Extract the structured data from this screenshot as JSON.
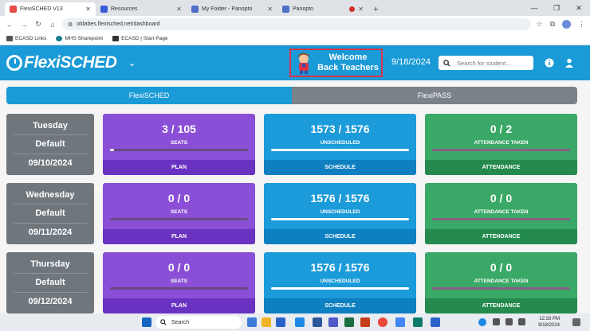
{
  "browser": {
    "tabs": [
      {
        "label": "FlexiSCHED V13",
        "active": true,
        "color": "#e54b4b"
      },
      {
        "label": "Resources",
        "active": false,
        "color": "#3a5bd9"
      },
      {
        "label": "My Folder - Panopto",
        "active": false,
        "color": "#4f6fc9"
      },
      {
        "label": "Panopto",
        "active": false,
        "color": "#4f6fc9"
      }
    ],
    "url": "oldabes.flexisched.net/dashboard",
    "bookmarks": [
      "ECASD Links",
      "MHS Sharepoint",
      "ECASD | Start Page"
    ]
  },
  "header": {
    "logo": "FlexiSCHED",
    "welcome": "Welcome Back Teachers",
    "date": "9/18/2024",
    "search_placeholder": "Search for student..."
  },
  "toggle": {
    "left": "FlexiSCHED",
    "right": "FlexiPASS"
  },
  "rows": [
    {
      "day": "Tuesday",
      "type": "Default",
      "date": "09/10/2024",
      "plan": {
        "count": "3 / 105",
        "label": "SEATS",
        "progress": 0.03,
        "action": "PLAN"
      },
      "schedule": {
        "count": "1573 / 1576",
        "label": "UNSCHEDULED",
        "progress": 0.998,
        "action": "SCHEDULE"
      },
      "attendance": {
        "count": "0 / 2",
        "label": "ATTENDANCE TAKEN",
        "progress": 0,
        "action": "ATTENDANCE"
      }
    },
    {
      "day": "Wednesday",
      "type": "Default",
      "date": "09/11/2024",
      "plan": {
        "count": "0 / 0",
        "label": "SEATS",
        "progress": 0,
        "action": "PLAN"
      },
      "schedule": {
        "count": "1576 / 1576",
        "label": "UNSCHEDULED",
        "progress": 1,
        "action": "SCHEDULE"
      },
      "attendance": {
        "count": "0 / 0",
        "label": "ATTENDANCE TAKEN",
        "progress": 0,
        "action": "ATTENDANCE"
      }
    },
    {
      "day": "Thursday",
      "type": "Default",
      "date": "09/12/2024",
      "plan": {
        "count": "0 / 0",
        "label": "SEATS",
        "progress": 0,
        "action": "PLAN"
      },
      "schedule": {
        "count": "1576 / 1576",
        "label": "UNSCHEDULED",
        "progress": 1,
        "action": "SCHEDULE"
      },
      "attendance": {
        "count": "0 / 0",
        "label": "ATTENDANCE TAKEN",
        "progress": 0,
        "action": "ATTENDANCE"
      }
    }
  ],
  "taskbar": {
    "search": "Search",
    "time": "12:33 PM",
    "date": "9/18/2024"
  }
}
